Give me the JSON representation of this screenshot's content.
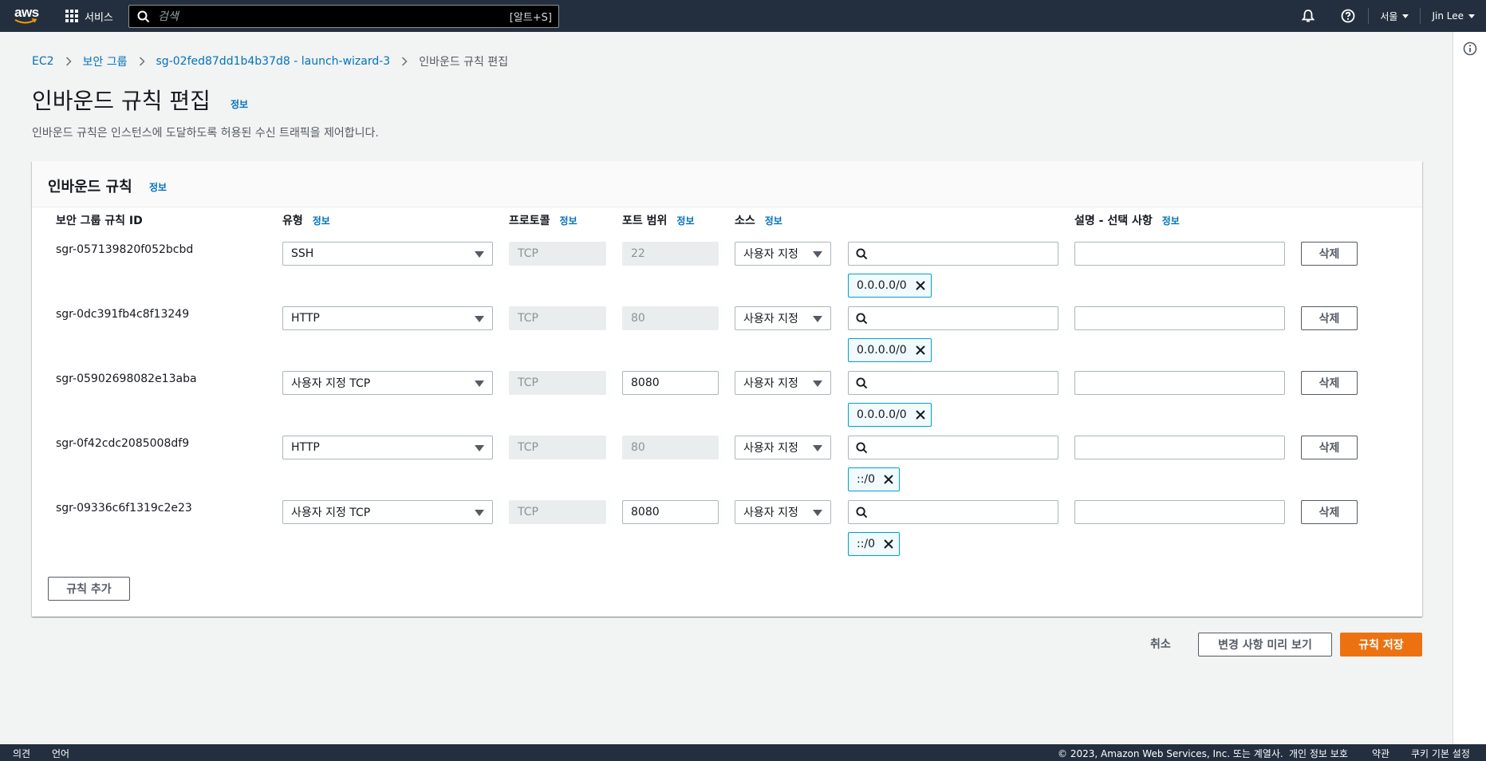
{
  "topnav": {
    "logo_text": "aws",
    "services_label": "서비스",
    "search_placeholder": "검색",
    "search_shortcut": "[알트+S]",
    "region_label": "서울",
    "user_label": "Jin Lee"
  },
  "breadcrumb": {
    "ec2": "EC2",
    "security_groups": "보안 그룹",
    "sg": "sg-02fed87dd1b4b37d8 - launch-wizard-3",
    "current": "인바운드 규칙 편집"
  },
  "page": {
    "title": "인바운드 규칙 편집",
    "info": "정보",
    "description": "인바운드 규칙은 인스턴스에 도달하도록 허용된 수신 트래픽을 제어합니다."
  },
  "panel": {
    "title": "인바운드 규칙",
    "info": "정보",
    "columns": {
      "rule_id": "보안 그룹 규칙 ID",
      "type": "유형",
      "protocol": "프로토콜",
      "port_range": "포트 범위",
      "source": "소스",
      "description": "설명 - 선택 사항",
      "info": "정보"
    },
    "rules": [
      {
        "id": "sgr-057139820f052bcbd",
        "type": "SSH",
        "protocol": "TCP",
        "port": "22",
        "port_editable": false,
        "source": "사용자 지정",
        "cidr": "0.0.0.0/0",
        "delete": "삭제"
      },
      {
        "id": "sgr-0dc391fb4c8f13249",
        "type": "HTTP",
        "protocol": "TCP",
        "port": "80",
        "port_editable": false,
        "source": "사용자 지정",
        "cidr": "0.0.0.0/0",
        "delete": "삭제"
      },
      {
        "id": "sgr-05902698082e13aba",
        "type": "사용자 지정 TCP",
        "protocol": "TCP",
        "port": "8080",
        "port_editable": true,
        "source": "사용자 지정",
        "cidr": "0.0.0.0/0",
        "delete": "삭제"
      },
      {
        "id": "sgr-0f42cdc2085008df9",
        "type": "HTTP",
        "protocol": "TCP",
        "port": "80",
        "port_editable": false,
        "source": "사용자 지정",
        "cidr": "::/0",
        "delete": "삭제"
      },
      {
        "id": "sgr-09336c6f1319c2e23",
        "type": "사용자 지정 TCP",
        "protocol": "TCP",
        "port": "8080",
        "port_editable": true,
        "source": "사용자 지정",
        "cidr": "::/0",
        "delete": "삭제"
      }
    ],
    "add_rule": "규칙 추가"
  },
  "actions": {
    "cancel": "취소",
    "preview": "변경 사항 미리 보기",
    "save": "규칙 저장"
  },
  "footer": {
    "feedback": "의견",
    "language": "언어",
    "copyright": "© 2023, Amazon Web Services, Inc. 또는 계열사.",
    "privacy": "개인 정보 보호",
    "terms": "약관",
    "cookies": "쿠키 기본 설정"
  },
  "colors": {
    "nav_bg": "#232f3e",
    "link": "#0073bb",
    "primary": "#ec7211",
    "token_border": "#00a1c9"
  }
}
